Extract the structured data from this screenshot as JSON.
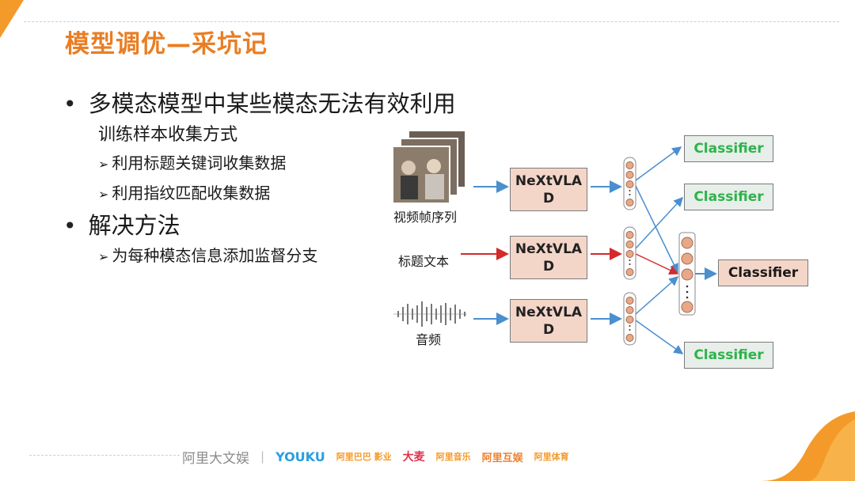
{
  "title": "模型调优—采坑记",
  "bullets": {
    "b1": "多模态模型中某些模态无法有效利用",
    "b1_sub": "训练样本收集方式",
    "b1_items": [
      "利用标题关键词收集数据",
      "利用指纹匹配收集数据"
    ],
    "b2": "解决方法",
    "b2_items": [
      "为每种模态信息添加监督分支"
    ]
  },
  "diagram": {
    "inputs": [
      "视频帧序列",
      "标题文本",
      "音频"
    ],
    "encoder_label": "NeXtVLA\nD",
    "classifier_label": "Classifier",
    "colors": {
      "blue": "#4a8fcf",
      "red": "#d42a2a",
      "node": "#e8a888",
      "green": "#2db34a"
    }
  },
  "footer": {
    "brand": "阿里大文娱",
    "separator": "|",
    "logos": [
      "YOUKU",
      "阿里巴巴 影业",
      "大麦",
      "阿里音乐",
      "阿里互娱",
      "阿里体育"
    ]
  }
}
